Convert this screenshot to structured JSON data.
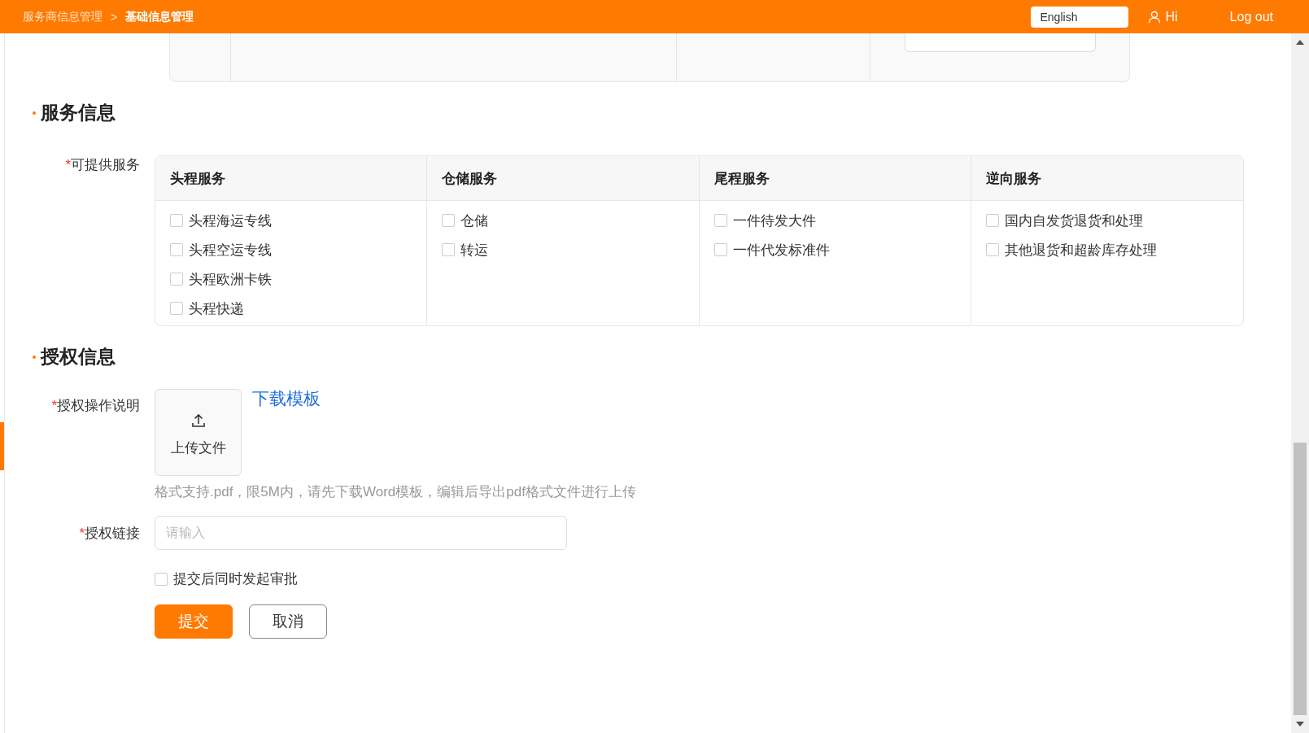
{
  "header": {
    "breadcrumb": [
      "服务商信息管理",
      "基础信息管理"
    ],
    "separator": ">",
    "language": "English",
    "user": "Hi",
    "logout": "Log out"
  },
  "service_section": {
    "title": "服务信息",
    "field": {
      "required_mark": "*",
      "label": "可提供服务"
    },
    "columns": [
      {
        "title": "头程服务",
        "options": [
          {
            "label": "头程海运专线",
            "checked": false
          },
          {
            "label": "头程空运专线",
            "checked": false
          },
          {
            "label": "头程欧洲卡铁",
            "checked": false
          },
          {
            "label": "头程快递",
            "checked": false
          }
        ]
      },
      {
        "title": "仓储服务",
        "options": [
          {
            "label": "仓储",
            "checked": false
          },
          {
            "label": "转运",
            "checked": false
          }
        ]
      },
      {
        "title": "尾程服务",
        "options": [
          {
            "label": "一件待发大件",
            "checked": false
          },
          {
            "label": "一件代发标准件",
            "checked": false
          }
        ]
      },
      {
        "title": "逆向服务",
        "options": [
          {
            "label": "国内自发货退货和处理",
            "checked": false
          },
          {
            "label": "其他退货和超龄库存处理",
            "checked": false
          }
        ]
      }
    ]
  },
  "auth_section": {
    "title": "授权信息",
    "upload": {
      "required_mark": "*",
      "label": "授权操作说明",
      "button": "上传文件",
      "download_link": "下载模板",
      "hint": "格式支持.pdf，限5M内，请先下载Word模板，编辑后导出pdf格式文件进行上传"
    },
    "link": {
      "required_mark": "*",
      "label": "授权链接",
      "placeholder": "请输入"
    },
    "approval": {
      "label": "提交后同时发起审批",
      "checked": false
    },
    "buttons": [
      {
        "label": "提交",
        "kind": "primary"
      },
      {
        "label": "取消",
        "kind": "default"
      }
    ]
  }
}
